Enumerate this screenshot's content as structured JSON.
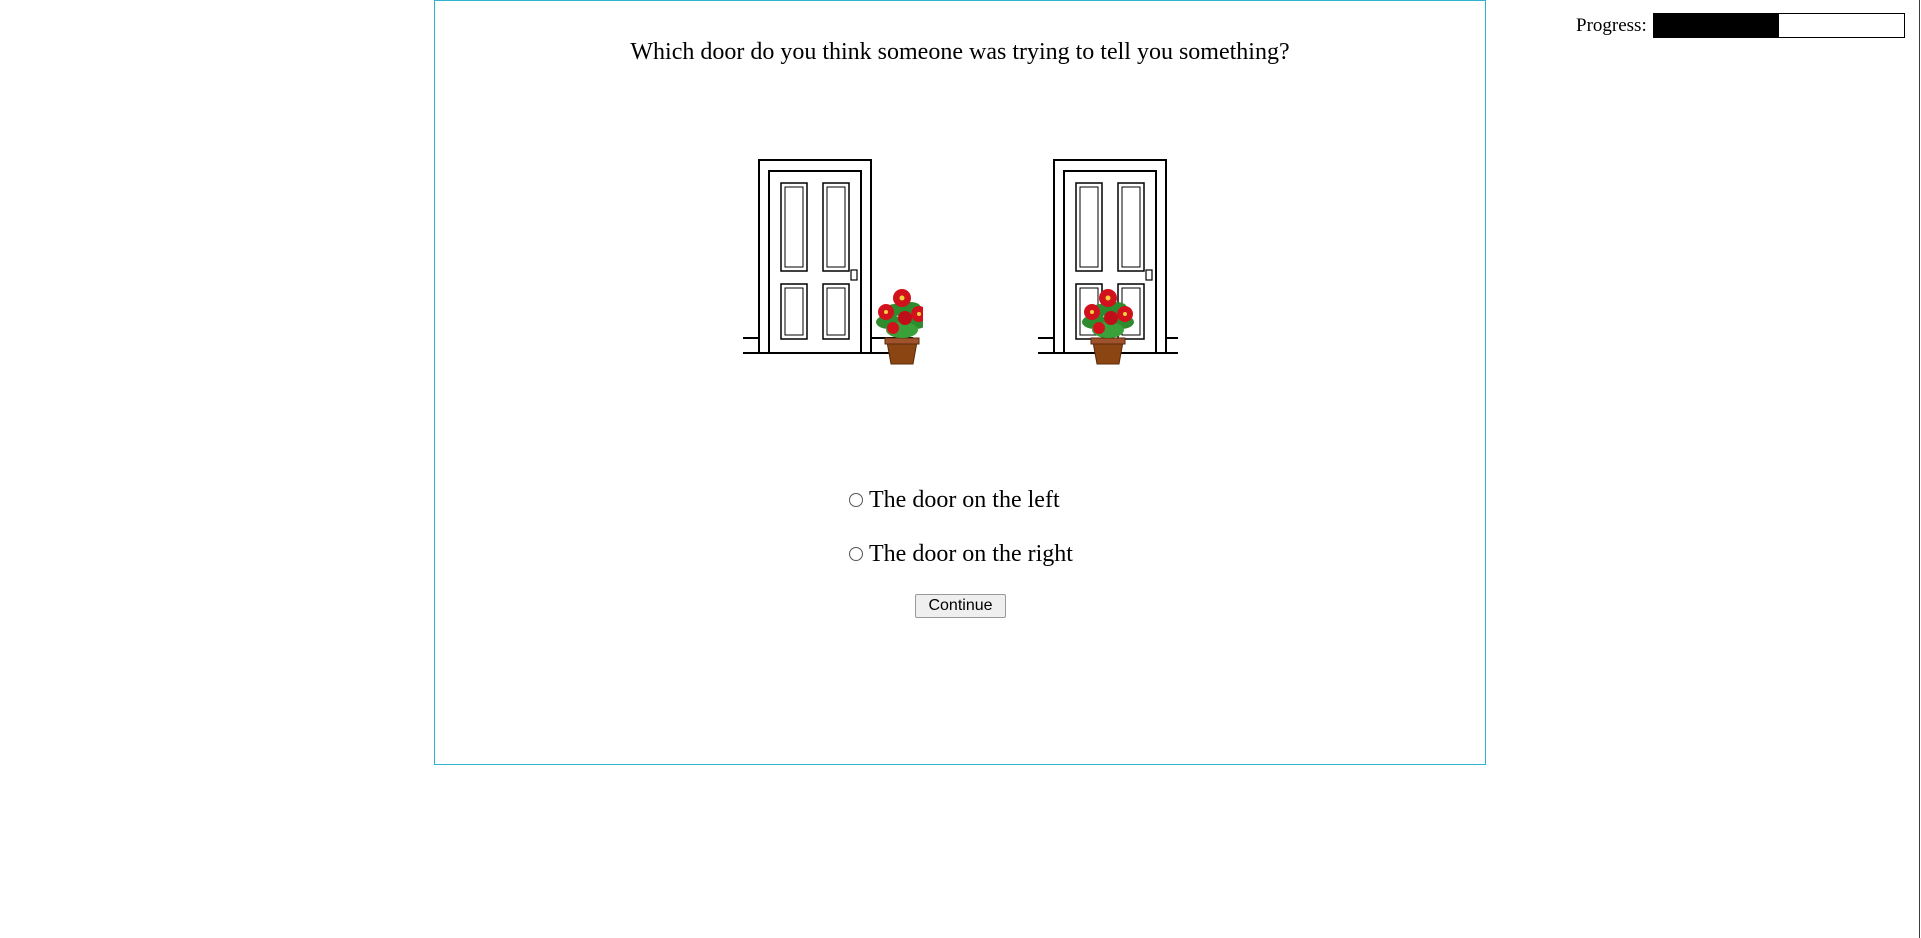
{
  "progress": {
    "label": "Progress:",
    "value": 0.5
  },
  "question": {
    "text": "Which door do you think someone was trying to tell you something?"
  },
  "scene": {
    "left_door": {
      "icon": "door-icon",
      "flowerpot": "flowerpot-icon",
      "flowerpot_position": "beside door"
    },
    "right_door": {
      "icon": "door-icon",
      "flowerpot": "flowerpot-icon",
      "flowerpot_position": "in front of door"
    }
  },
  "options": [
    {
      "label": "The door on the left",
      "selected": false
    },
    {
      "label": "The door on the right",
      "selected": false
    }
  ],
  "continue_button": {
    "label": "Continue"
  },
  "colors": {
    "panel_border": "#31b3cf",
    "flower_red": "#d1121c",
    "leaf_green": "#2e8b2e",
    "pot_brown": "#8b4513"
  }
}
